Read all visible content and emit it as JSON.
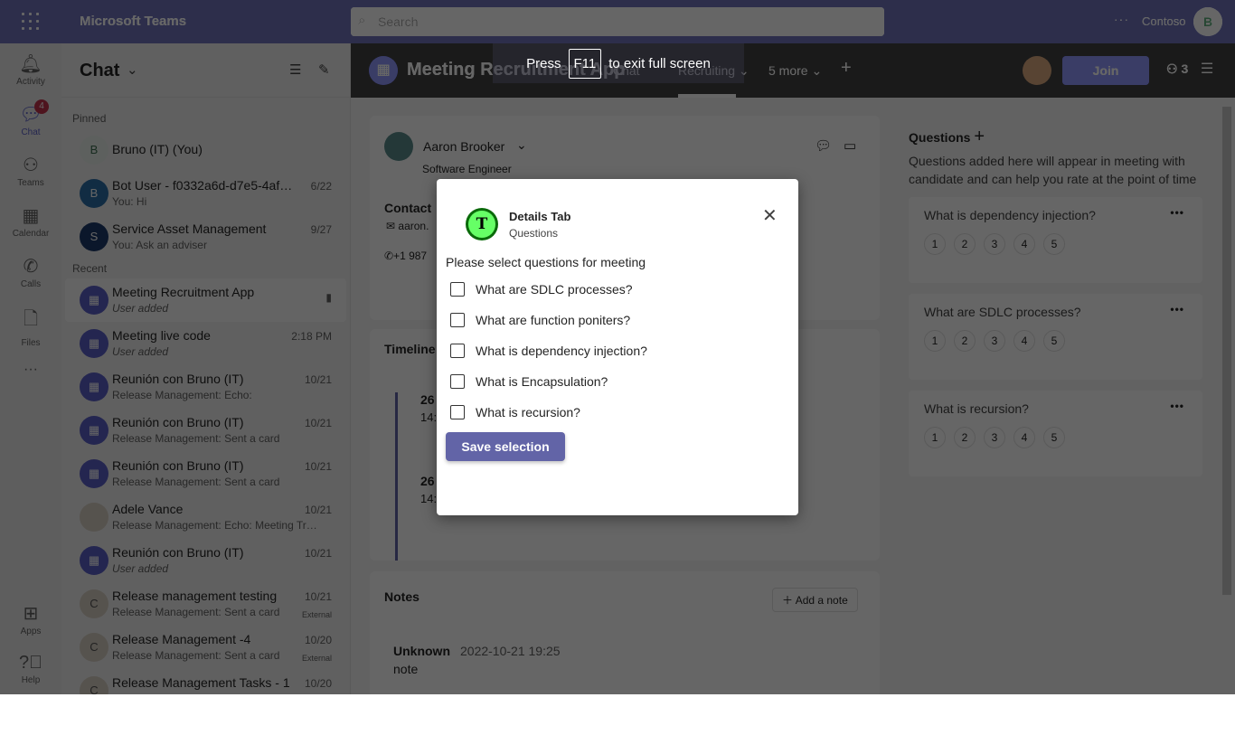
{
  "app": {
    "title": "Microsoft Teams",
    "search_placeholder": "Search",
    "more": "···",
    "org": "Contoso",
    "avatar": "B"
  },
  "rail": [
    {
      "label": "Activity",
      "icon": "bell-icon"
    },
    {
      "label": "Chat",
      "icon": "chat-icon",
      "badge": "4"
    },
    {
      "label": "Teams",
      "icon": "teams-icon"
    },
    {
      "label": "Calendar",
      "icon": "calendar-icon"
    },
    {
      "label": "Calls",
      "icon": "phone-icon"
    },
    {
      "label": "Files",
      "icon": "file-icon"
    },
    {
      "label": "···"
    },
    {
      "label": "Apps",
      "icon": "apps-icon"
    },
    {
      "label": "Help",
      "icon": "help-icon"
    }
  ],
  "chatlist": {
    "title": "Chat",
    "pinned": "Pinned",
    "recent": "Recent",
    "pinned_items": [
      {
        "avatar": "B",
        "name": "Bruno (IT) (You)",
        "preview": "",
        "date": ""
      },
      {
        "avatar": "B",
        "name": "Bot User - f0332a6d-d7e5-4af4-...",
        "preview": "You: Hi",
        "date": "6/22"
      },
      {
        "avatar": "S",
        "name": "Service Asset Management",
        "preview": "You: Ask an adviser",
        "date": "9/27"
      }
    ],
    "recent_items": [
      {
        "name": "Meeting Recruitment App",
        "preview": "User added",
        "date": ""
      },
      {
        "name": "Meeting live code",
        "preview": "User added",
        "date": "2:18 PM"
      },
      {
        "name": "Reunión con Bruno (IT)",
        "preview": "Release Management: Echo:",
        "date": "10/21"
      },
      {
        "name": "Reunión con Bruno (IT)",
        "preview": "Release Management: Sent a card",
        "date": "10/21"
      },
      {
        "name": "Reunión con Bruno (IT)",
        "preview": "Release Management: Sent a card",
        "date": "10/21"
      },
      {
        "name": "Adele Vance",
        "preview": "Release Management: Echo: Meeting Tra...",
        "date": "10/21"
      },
      {
        "name": "Reunión con Bruno (IT)",
        "preview": "User added",
        "date": "10/21"
      },
      {
        "name": "Release management testing",
        "preview": "Release Management: Sent a card",
        "date": "10/21",
        "tag": "External"
      },
      {
        "name": "Release Management -4",
        "preview": "Release Management: Sent a card",
        "date": "10/20",
        "tag": "External"
      },
      {
        "name": "Release Management Tasks - 1",
        "preview": "",
        "date": "10/20"
      }
    ]
  },
  "meeting": {
    "title": "Meeting Recruitment App",
    "tabs": [
      "Chat",
      "Recruiting ⌄",
      "5 more ⌄"
    ],
    "join": "Join",
    "participants": "3"
  },
  "fullscreen": {
    "press": "Press",
    "key": "F11",
    "rest": "to exit full screen"
  },
  "candidate": {
    "name": "Aaron Brooker",
    "role": "Software Engineer",
    "contact": "Contact",
    "email": "aaron.",
    "phone": "+1 987",
    "timeline": "Timeline",
    "t1d": "26",
    "t1t": "14:",
    "t2d": "26",
    "t2t": "14:"
  },
  "notes": {
    "title": "Notes",
    "add": "Add a note",
    "author": "Unknown",
    "time": "2022-10-21 19:25",
    "text": "note"
  },
  "questions": {
    "title": "Questions",
    "desc": "Questions added here will appear in meeting with candidate and can help you rate at the point of time",
    "items": [
      "What is dependency injection?",
      "What are SDLC processes?",
      "What is recursion?"
    ],
    "ratings": [
      "1",
      "2",
      "3",
      "4",
      "5"
    ]
  },
  "dialog": {
    "title": "Details Tab",
    "subtitle": "Questions",
    "logo_letter": "T",
    "prompt": "Please select questions for meeting",
    "options": [
      "What are SDLC processes?",
      "What are function poniters?",
      "What is dependency injection?",
      "What is Encapsulation?",
      "What is recursion?"
    ],
    "save": "Save selection"
  }
}
